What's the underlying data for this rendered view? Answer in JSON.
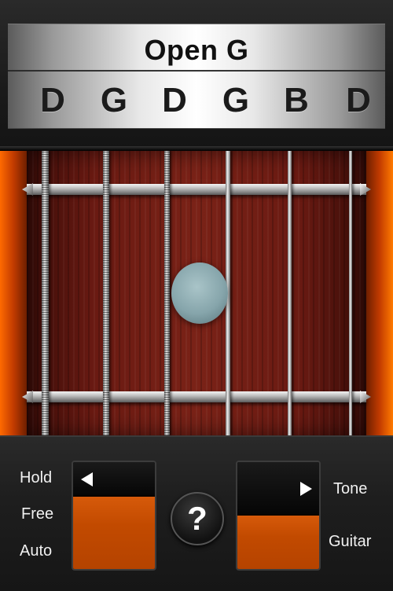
{
  "tuning": {
    "name": "Open G",
    "notes": [
      "D",
      "G",
      "D",
      "G",
      "B",
      "D"
    ]
  },
  "fretboard": {
    "frets": 2,
    "strings": 6,
    "marker_string": 3,
    "marker_icon": "pick-marker"
  },
  "controls": {
    "left_labels": [
      "Hold",
      "Free",
      "Auto"
    ],
    "right_labels": [
      "Tone",
      "Guitar"
    ],
    "help_label": "?",
    "left_switch_arrow": "left-arrow-icon",
    "right_switch_arrow": "right-arrow-icon"
  },
  "colors": {
    "accent_orange": "#c24a00",
    "glow_orange": "#ff6a00",
    "fretboard_wood": "#6a1a12",
    "display_bg": "#ffffff",
    "text_dark": "#111111",
    "label_text": "#f1f1f1"
  }
}
